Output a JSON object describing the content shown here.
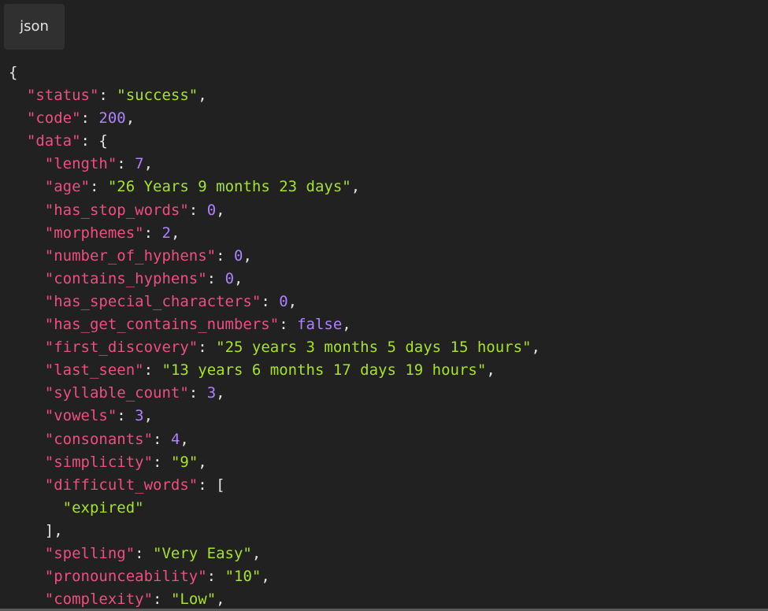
{
  "header": {
    "language_label": "json"
  },
  "colors": {
    "background": "#212121",
    "key": "#ee4f7e",
    "string": "#a6e22e",
    "number": "#ae81ff",
    "punctuation": "#e6e6e6"
  },
  "code_lines": [
    [
      {
        "t": "p",
        "v": "{"
      }
    ],
    [
      {
        "t": "p",
        "v": "  "
      },
      {
        "t": "k",
        "v": "\"status\""
      },
      {
        "t": "p",
        "v": ": "
      },
      {
        "t": "s",
        "v": "\"success\""
      },
      {
        "t": "p",
        "v": ","
      }
    ],
    [
      {
        "t": "p",
        "v": "  "
      },
      {
        "t": "k",
        "v": "\"code\""
      },
      {
        "t": "p",
        "v": ": "
      },
      {
        "t": "n",
        "v": "200"
      },
      {
        "t": "p",
        "v": ","
      }
    ],
    [
      {
        "t": "p",
        "v": "  "
      },
      {
        "t": "k",
        "v": "\"data\""
      },
      {
        "t": "p",
        "v": ": {"
      }
    ],
    [
      {
        "t": "p",
        "v": "    "
      },
      {
        "t": "k",
        "v": "\"length\""
      },
      {
        "t": "p",
        "v": ": "
      },
      {
        "t": "n",
        "v": "7"
      },
      {
        "t": "p",
        "v": ","
      }
    ],
    [
      {
        "t": "p",
        "v": "    "
      },
      {
        "t": "k",
        "v": "\"age\""
      },
      {
        "t": "p",
        "v": ": "
      },
      {
        "t": "s",
        "v": "\"26 Years 9 months 23 days\""
      },
      {
        "t": "p",
        "v": ","
      }
    ],
    [
      {
        "t": "p",
        "v": "    "
      },
      {
        "t": "k",
        "v": "\"has_stop_words\""
      },
      {
        "t": "p",
        "v": ": "
      },
      {
        "t": "n",
        "v": "0"
      },
      {
        "t": "p",
        "v": ","
      }
    ],
    [
      {
        "t": "p",
        "v": "    "
      },
      {
        "t": "k",
        "v": "\"morphemes\""
      },
      {
        "t": "p",
        "v": ": "
      },
      {
        "t": "n",
        "v": "2"
      },
      {
        "t": "p",
        "v": ","
      }
    ],
    [
      {
        "t": "p",
        "v": "    "
      },
      {
        "t": "k",
        "v": "\"number_of_hyphens\""
      },
      {
        "t": "p",
        "v": ": "
      },
      {
        "t": "n",
        "v": "0"
      },
      {
        "t": "p",
        "v": ","
      }
    ],
    [
      {
        "t": "p",
        "v": "    "
      },
      {
        "t": "k",
        "v": "\"contains_hyphens\""
      },
      {
        "t": "p",
        "v": ": "
      },
      {
        "t": "n",
        "v": "0"
      },
      {
        "t": "p",
        "v": ","
      }
    ],
    [
      {
        "t": "p",
        "v": "    "
      },
      {
        "t": "k",
        "v": "\"has_special_characters\""
      },
      {
        "t": "p",
        "v": ": "
      },
      {
        "t": "n",
        "v": "0"
      },
      {
        "t": "p",
        "v": ","
      }
    ],
    [
      {
        "t": "p",
        "v": "    "
      },
      {
        "t": "k",
        "v": "\"has_get_contains_numbers\""
      },
      {
        "t": "p",
        "v": ": "
      },
      {
        "t": "n",
        "v": "false"
      },
      {
        "t": "p",
        "v": ","
      }
    ],
    [
      {
        "t": "p",
        "v": "    "
      },
      {
        "t": "k",
        "v": "\"first_discovery\""
      },
      {
        "t": "p",
        "v": ": "
      },
      {
        "t": "s",
        "v": "\"25 years 3 months 5 days 15 hours\""
      },
      {
        "t": "p",
        "v": ","
      }
    ],
    [
      {
        "t": "p",
        "v": "    "
      },
      {
        "t": "k",
        "v": "\"last_seen\""
      },
      {
        "t": "p",
        "v": ": "
      },
      {
        "t": "s",
        "v": "\"13 years 6 months 17 days 19 hours\""
      },
      {
        "t": "p",
        "v": ","
      }
    ],
    [
      {
        "t": "p",
        "v": "    "
      },
      {
        "t": "k",
        "v": "\"syllable_count\""
      },
      {
        "t": "p",
        "v": ": "
      },
      {
        "t": "n",
        "v": "3"
      },
      {
        "t": "p",
        "v": ","
      }
    ],
    [
      {
        "t": "p",
        "v": "    "
      },
      {
        "t": "k",
        "v": "\"vowels\""
      },
      {
        "t": "p",
        "v": ": "
      },
      {
        "t": "n",
        "v": "3"
      },
      {
        "t": "p",
        "v": ","
      }
    ],
    [
      {
        "t": "p",
        "v": "    "
      },
      {
        "t": "k",
        "v": "\"consonants\""
      },
      {
        "t": "p",
        "v": ": "
      },
      {
        "t": "n",
        "v": "4"
      },
      {
        "t": "p",
        "v": ","
      }
    ],
    [
      {
        "t": "p",
        "v": "    "
      },
      {
        "t": "k",
        "v": "\"simplicity\""
      },
      {
        "t": "p",
        "v": ": "
      },
      {
        "t": "s",
        "v": "\"9\""
      },
      {
        "t": "p",
        "v": ","
      }
    ],
    [
      {
        "t": "p",
        "v": "    "
      },
      {
        "t": "k",
        "v": "\"difficult_words\""
      },
      {
        "t": "p",
        "v": ": ["
      }
    ],
    [
      {
        "t": "p",
        "v": "      "
      },
      {
        "t": "s",
        "v": "\"expired\""
      }
    ],
    [
      {
        "t": "p",
        "v": "    ],"
      }
    ],
    [
      {
        "t": "p",
        "v": "    "
      },
      {
        "t": "k",
        "v": "\"spelling\""
      },
      {
        "t": "p",
        "v": ": "
      },
      {
        "t": "s",
        "v": "\"Very Easy\""
      },
      {
        "t": "p",
        "v": ","
      }
    ],
    [
      {
        "t": "p",
        "v": "    "
      },
      {
        "t": "k",
        "v": "\"pronounceability\""
      },
      {
        "t": "p",
        "v": ": "
      },
      {
        "t": "s",
        "v": "\"10\""
      },
      {
        "t": "p",
        "v": ","
      }
    ],
    [
      {
        "t": "p",
        "v": "    "
      },
      {
        "t": "k",
        "v": "\"complexity\""
      },
      {
        "t": "p",
        "v": ": "
      },
      {
        "t": "s",
        "v": "\"Low\""
      },
      {
        "t": "p",
        "v": ","
      }
    ]
  ]
}
